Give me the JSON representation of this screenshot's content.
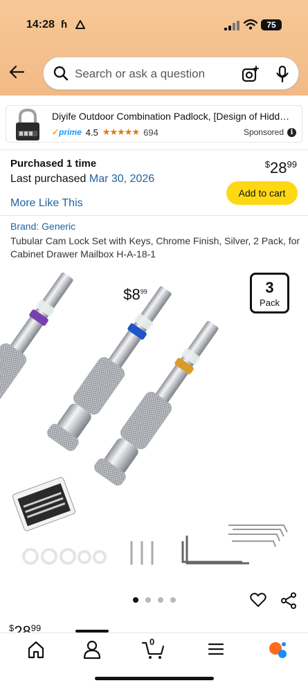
{
  "status_bar": {
    "time": "14:28",
    "extra": "ɦ",
    "battery": "75"
  },
  "search": {
    "placeholder": "Search or ask a question"
  },
  "sponsored_ad": {
    "title": "Diyife Outdoor Combination Padlock, [Design of Hidden...",
    "price_dollars": "8",
    "price_cents": "99",
    "currency": "$",
    "prime": "prime",
    "rating": "4.5",
    "stars": "★★★★★",
    "review_count": "694",
    "label": "Sponsored",
    "info": "i"
  },
  "purchase": {
    "purchased_label": "Purchased 1 time",
    "last_purchased_label": "Last purchased",
    "last_purchased_date": "Mar 30, 2026",
    "price_currency": "$",
    "price_dollars": "28",
    "price_cents": "99",
    "add_to_cart": "Add to cart",
    "more_like_this": "More Like This"
  },
  "product": {
    "brand": "Brand: Generic",
    "title": "Tubular Cam Lock Set with Keys, Chrome Finish, Silver, 2 Pack, for Cabinet Drawer Mailbox H-A-18-1",
    "pack_count": "3",
    "pack_label": "Pack",
    "image_count": 4,
    "active_image": 1,
    "collar_colors": [
      "#7a3fb0",
      "#1f55c9",
      "#d99b2a"
    ]
  },
  "peek_price": {
    "currency": "$",
    "dollars": "28",
    "cents": "99"
  },
  "tabbar": {
    "cart_count": "0",
    "items": [
      "home-icon",
      "account-icon",
      "cart-icon",
      "menu-icon",
      "rufus-icon"
    ]
  }
}
